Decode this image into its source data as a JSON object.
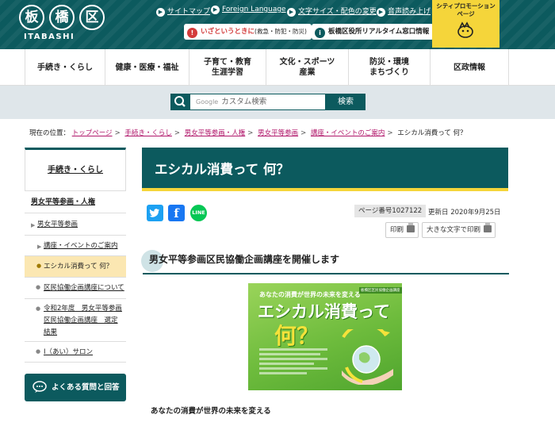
{
  "header": {
    "logo_chars": [
      "板",
      "橋",
      "区"
    ],
    "logo_sub": "ITABASHI",
    "links": [
      "サイトマップ",
      "Foreign Language",
      "文字サイズ・配色の変更",
      "音声読み上げ"
    ],
    "emergency_label": "いざというときに",
    "emergency_sub": "(救急・防犯・防災)",
    "realtime_label": "板橋区役所リアルタイム窓口情報",
    "promo_label": "シティプロモーションページ",
    "colors": {
      "primary": "#0c5a5e",
      "accent": "#f5d53a",
      "emergency": "#d33b3b"
    }
  },
  "nav": {
    "items": [
      {
        "label": "手続き・くらし"
      },
      {
        "label": "健康・医療・福祉"
      },
      {
        "label": "子育て・教育\n生涯学習"
      },
      {
        "label": "文化・スポーツ\n産業"
      },
      {
        "label": "防災・環境\nまちづくり"
      },
      {
        "label": "区政情報"
      }
    ]
  },
  "search": {
    "google_label": "Google",
    "placeholder": "カスタム検索",
    "button_label": "検索"
  },
  "breadcrumb": {
    "prefix": "現在の位置：",
    "links": [
      "トップページ",
      "手続き・くらし",
      "男女平等参画・人権",
      "男女平等参画",
      "講座・イベントのご案内"
    ],
    "current": "エシカル消費って 何？"
  },
  "sidebar": {
    "title": "手続き・くらし",
    "items": [
      {
        "label": "男女平等参画・人権"
      },
      {
        "label": "男女平等参画"
      },
      {
        "label": "講座・イベントのご案内"
      },
      {
        "label": "エシカル消費って 何？"
      },
      {
        "label": "区民協働企画講座について"
      },
      {
        "label": "令和2年度　男女平等参画区民協働企画講座　選定結果"
      },
      {
        "label": "I（あい）サロン"
      }
    ],
    "faq_label": "よくある質問と回答"
  },
  "main": {
    "title": "エシカル消費って 何？",
    "share": {
      "facebook": "f",
      "line": "LINE"
    },
    "page_number": "ページ番号1027122",
    "updated": "更新日 2020年9月25日",
    "print_label": "印刷",
    "large_print_label": "大きな文字で印刷",
    "section_heading": "男女平等参画区民協働企画講座を開催します",
    "poster": {
      "top_text": "あなたの消費が世界の未来を変える",
      "badge": "板橋区区民協働企画講座",
      "title": "エシカル消費って",
      "title2": "何？"
    },
    "caption": "あなたの消費が世界の未来を変える"
  }
}
